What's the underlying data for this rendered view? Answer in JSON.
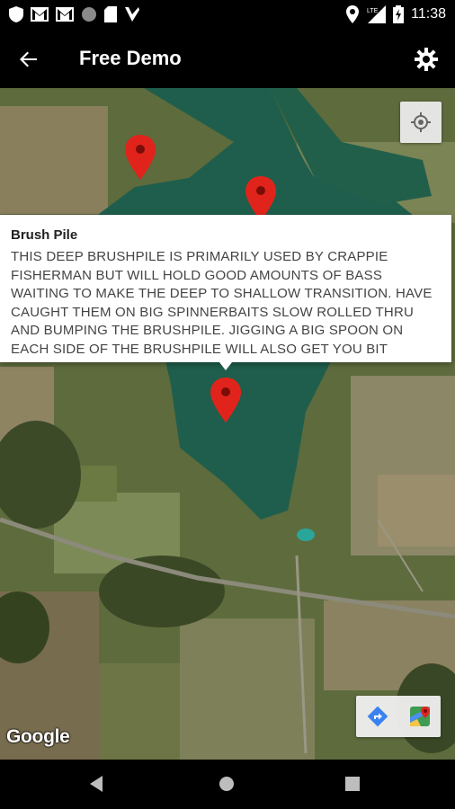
{
  "status_bar": {
    "time": "11:38",
    "left_icons": [
      "shield-icon",
      "gmail-icon",
      "gmail-icon",
      "circle-icon",
      "sd-card-icon",
      "verizon-icon"
    ],
    "right_icons": [
      "location-icon",
      "lte-signal-icon",
      "battery-charging-icon"
    ]
  },
  "app_bar": {
    "title": "Free Demo",
    "back_icon": "arrow-back-icon",
    "settings_icon": "gear-icon"
  },
  "map": {
    "provider_logo": "Google",
    "locate_icon": "my-location-icon",
    "tools": [
      "directions-icon",
      "google-maps-icon"
    ],
    "accent_pin_color": "#e0241b"
  },
  "info_window": {
    "title": "Brush Pile",
    "body": "THIS DEEP BRUSHPILE IS PRIMARILY USED BY CRAPPIE FISHERMAN BUT WILL HOLD GOOD AMOUNTS OF BASS WAITING TO MAKE THE DEEP TO SHALLOW TRANSITION. HAVE CAUGHT THEM ON BIG SPINNERBAITS SLOW ROLLED THRU AND BUMPING THE BRUSHPILE. JIGGING A BIG SPOON ON EACH SIDE OF THE BRUSHPILE WILL ALSO GET YOU BIT"
  },
  "nav_bar": {
    "buttons": [
      "back-triangle-icon",
      "home-circle-icon",
      "recents-square-icon"
    ]
  }
}
